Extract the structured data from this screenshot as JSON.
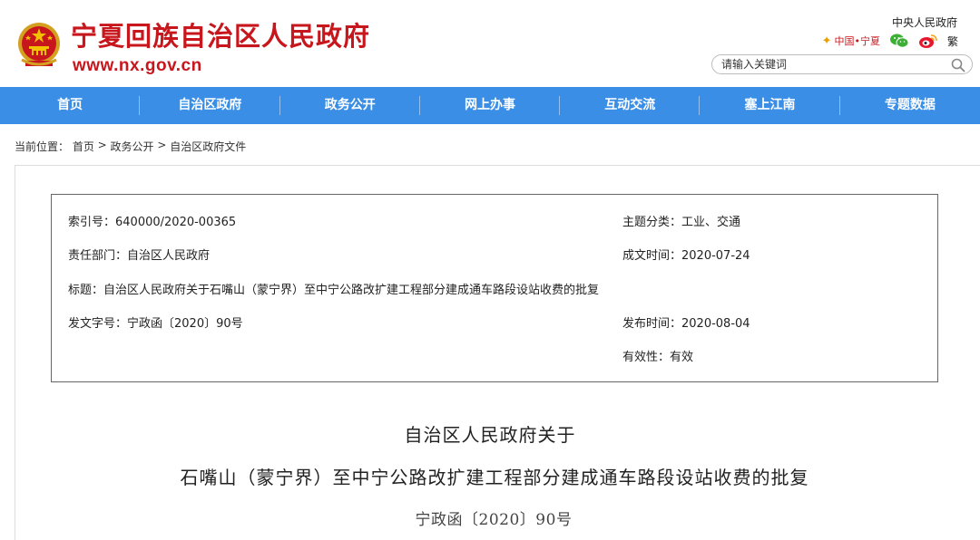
{
  "header": {
    "site_title": "宁夏回族自治区人民政府",
    "site_url": "www.nx.gov.cn",
    "top_link": "中央人民政府",
    "brand_text": "中国•宁夏",
    "traditional": "繁",
    "search_placeholder": "请输入关键词"
  },
  "nav": [
    {
      "label": "首页"
    },
    {
      "label": "自治区政府"
    },
    {
      "label": "政务公开"
    },
    {
      "label": "网上办事"
    },
    {
      "label": "互动交流"
    },
    {
      "label": "塞上江南"
    },
    {
      "label": "专题数据"
    }
  ],
  "breadcrumb": {
    "prefix": "当前位置：",
    "items": [
      "首页",
      "政务公开",
      "自治区政府文件"
    ],
    "separator": " > "
  },
  "meta": {
    "index_label": "索引号：",
    "index_value": "640000/2020-00365",
    "topic_label": "主题分类：",
    "topic_value": "工业、交通",
    "dept_label": "责任部门：",
    "dept_value": "自治区人民政府",
    "date_label": "成文时间：",
    "date_value": "2020-07-24",
    "title_label": "标题：",
    "title_value": "自治区人民政府关于石嘴山（蒙宁界）至中宁公路改扩建工程部分建成通车路段设站收费的批复",
    "docno_label": "发文字号：",
    "docno_value": "宁政函〔2020〕90号",
    "pub_label": "发布时间：",
    "pub_value": "2020-08-04",
    "valid_label": "有效性：",
    "valid_value": "有效"
  },
  "document": {
    "title_line1": "自治区人民政府关于",
    "title_line2": "石嘴山（蒙宁界）至中宁公路改扩建工程部分建成通车路段设站收费的批复",
    "number": "宁政函〔2020〕90号"
  },
  "colors": {
    "brand_red": "#c8161d",
    "nav_blue": "#3a8ee6"
  },
  "icons": {
    "emblem": "national-emblem-icon",
    "wechat": "wechat-icon",
    "weibo": "weibo-icon",
    "search": "search-icon"
  }
}
